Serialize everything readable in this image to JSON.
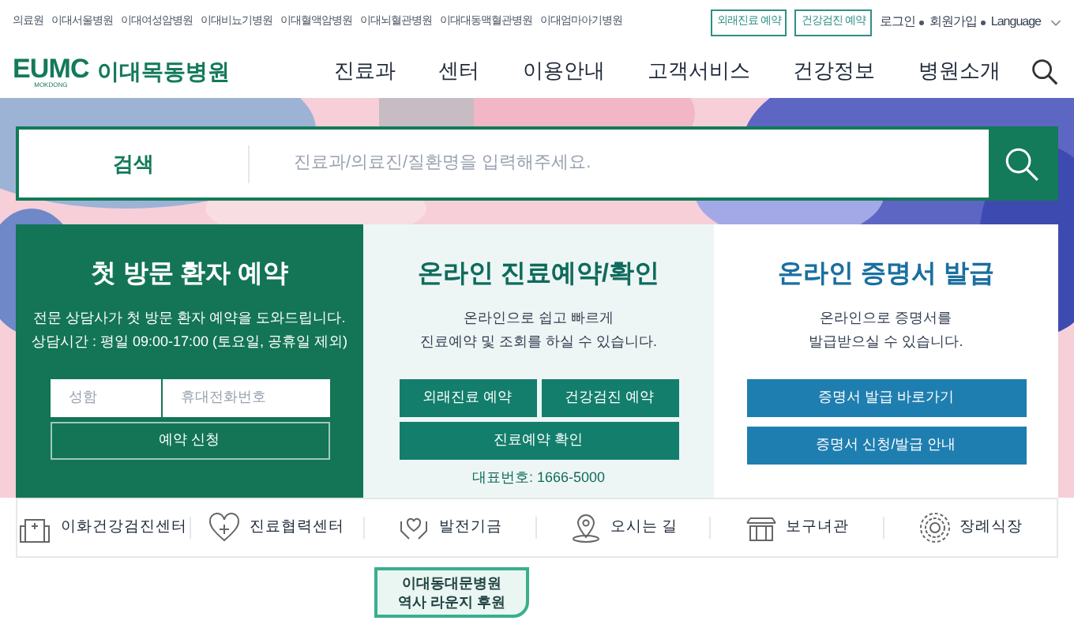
{
  "top_links": [
    "의료원",
    "이대서울병원",
    "이대여성암병원",
    "이대비뇨기병원",
    "이대혈액암병원",
    "이대뇌혈관병원",
    "이대대동맥혈관병원",
    "이대엄마아기병원"
  ],
  "top_buttons": [
    "외래진료 예약",
    "건강검진 예약"
  ],
  "account_links": [
    "로그인",
    "회원가입",
    "Language"
  ],
  "logo": {
    "mark": "EUMC",
    "sub": "MOKDONG",
    "name": "이대목동병원"
  },
  "nav": [
    "진료과",
    "센터",
    "이용안내",
    "고객서비스",
    "건강정보",
    "병원소개"
  ],
  "search": {
    "label": "검색",
    "placeholder": "진료과/의료진/질환명을 입력해주세요."
  },
  "first_visit": {
    "title": "첫 방문 환자 예약",
    "lines": [
      "전문 상담사가 첫 방문 환자 예약을 도와드립니다.",
      "상담시간 : 평일 09:00-17:00 (토요일, 공휴일 제외)"
    ],
    "name_placeholder": "성함",
    "phone_placeholder": "휴대전화번호",
    "button": "예약 신청"
  },
  "online_booking": {
    "title": "온라인 진료예약/확인",
    "lines": [
      "온라인으로 쉽고 빠르게",
      "진료예약 및 조회를 하실 수 있습니다."
    ],
    "buttons": [
      "외래진료 예약",
      "건강검진 예약",
      "진료예약 확인"
    ],
    "phone": "대표번호: 1666-5000"
  },
  "certificate": {
    "title": "온라인 증명서 발급",
    "lines": [
      "온라인으로 증명서를",
      "발급받으실 수 있습니다."
    ],
    "buttons": [
      "증명서 발급 바로가기",
      "증명서 신청/발급 안내"
    ]
  },
  "quick_links": [
    {
      "kind": "building",
      "label": "이화건강검진센터"
    },
    {
      "kind": "heart",
      "label": "진료협력센터"
    },
    {
      "kind": "hands",
      "label": "발전기금"
    },
    {
      "kind": "pin",
      "label": "오시는 길"
    },
    {
      "kind": "house",
      "label": "보구녀관"
    },
    {
      "kind": "flower",
      "label": "장례식장"
    }
  ],
  "tooltip": [
    "이대동대문병원",
    "역사 라운지 후원"
  ]
}
